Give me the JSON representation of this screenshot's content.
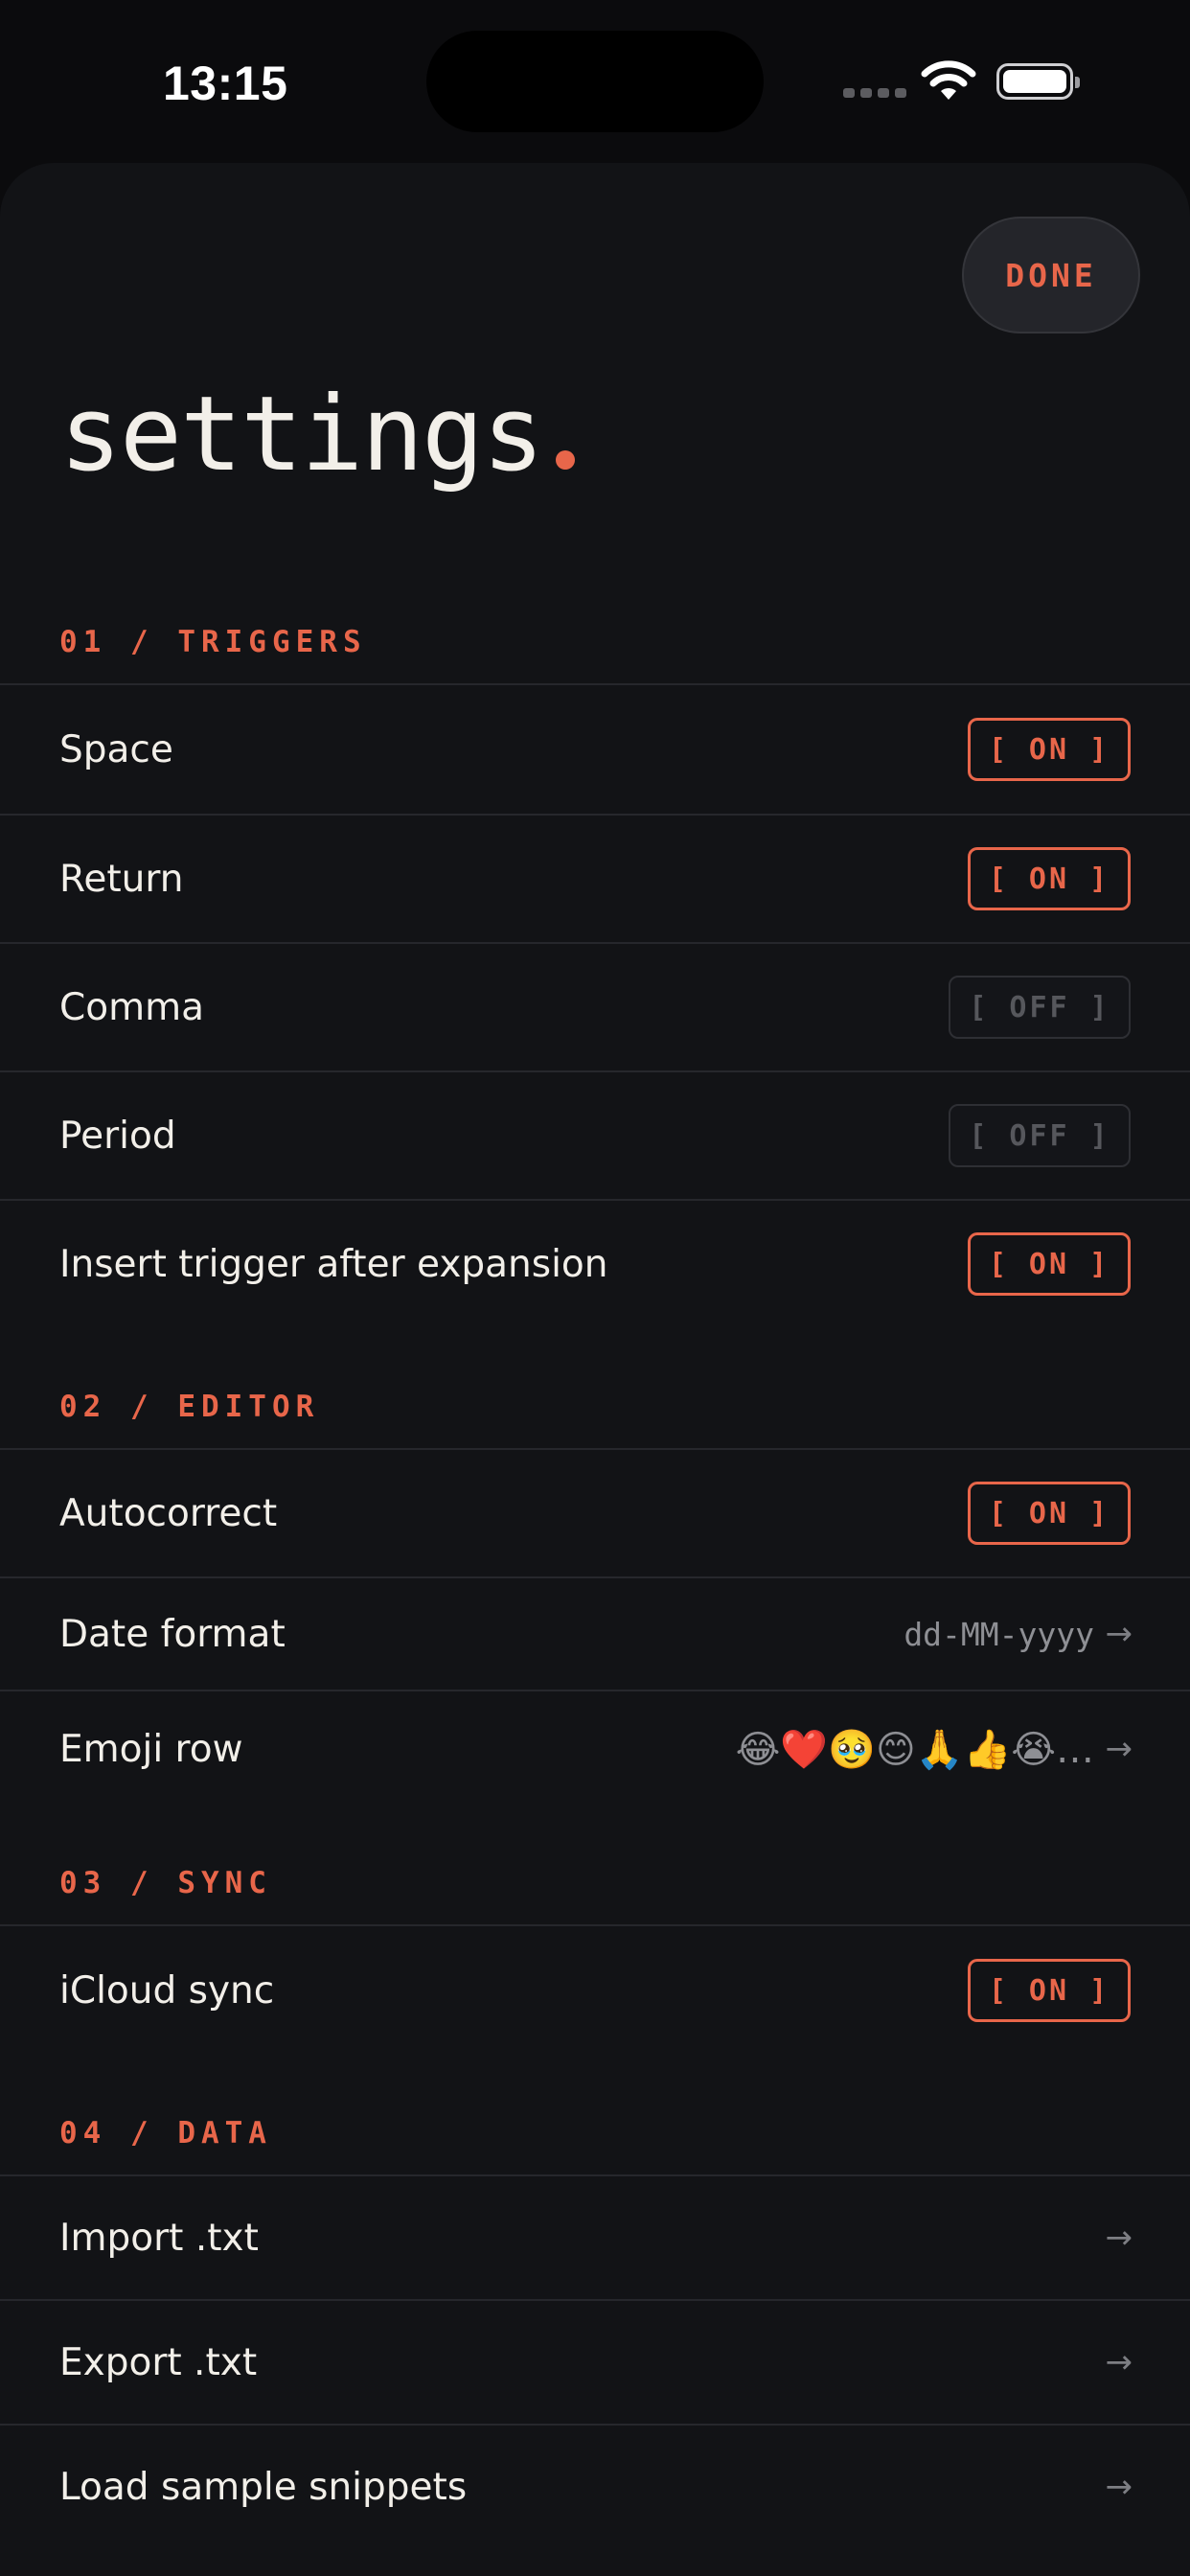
{
  "status_bar": {
    "time": "13:15"
  },
  "header": {
    "done_label": "DONE",
    "title": "settings"
  },
  "sections": {
    "triggers": {
      "heading": "01 / TRIGGERS",
      "space": {
        "label": "Space",
        "toggle": "[ ON ]"
      },
      "return": {
        "label": "Return",
        "toggle": "[ ON ]"
      },
      "comma": {
        "label": "Comma",
        "toggle": "[ OFF ]"
      },
      "period": {
        "label": "Period",
        "toggle": "[ OFF ]"
      },
      "insert_trigger": {
        "label": "Insert trigger after expansion",
        "toggle": "[ ON ]"
      }
    },
    "editor": {
      "heading": "02 / EDITOR",
      "autocorrect": {
        "label": "Autocorrect",
        "toggle": "[ ON ]"
      },
      "date_format": {
        "label": "Date format",
        "value": "dd-MM-yyyy"
      },
      "emoji_row": {
        "label": "Emoji row",
        "value": "😂❤️🥹😊🙏👍😭…"
      }
    },
    "sync": {
      "heading": "03 / SYNC",
      "icloud": {
        "label": "iCloud sync",
        "toggle": "[ ON ]"
      }
    },
    "data": {
      "heading": "04 / DATA",
      "import": {
        "label": "Import .txt"
      },
      "export": {
        "label": "Export .txt"
      },
      "load_samples": {
        "label": "Load sample snippets"
      }
    }
  },
  "colors": {
    "accent": "#e8664a",
    "background": "#121316",
    "text": "#f2efe9"
  },
  "icons": {
    "arrow": "arrow-right-icon",
    "wifi": "wifi-icon",
    "battery": "battery-icon"
  }
}
